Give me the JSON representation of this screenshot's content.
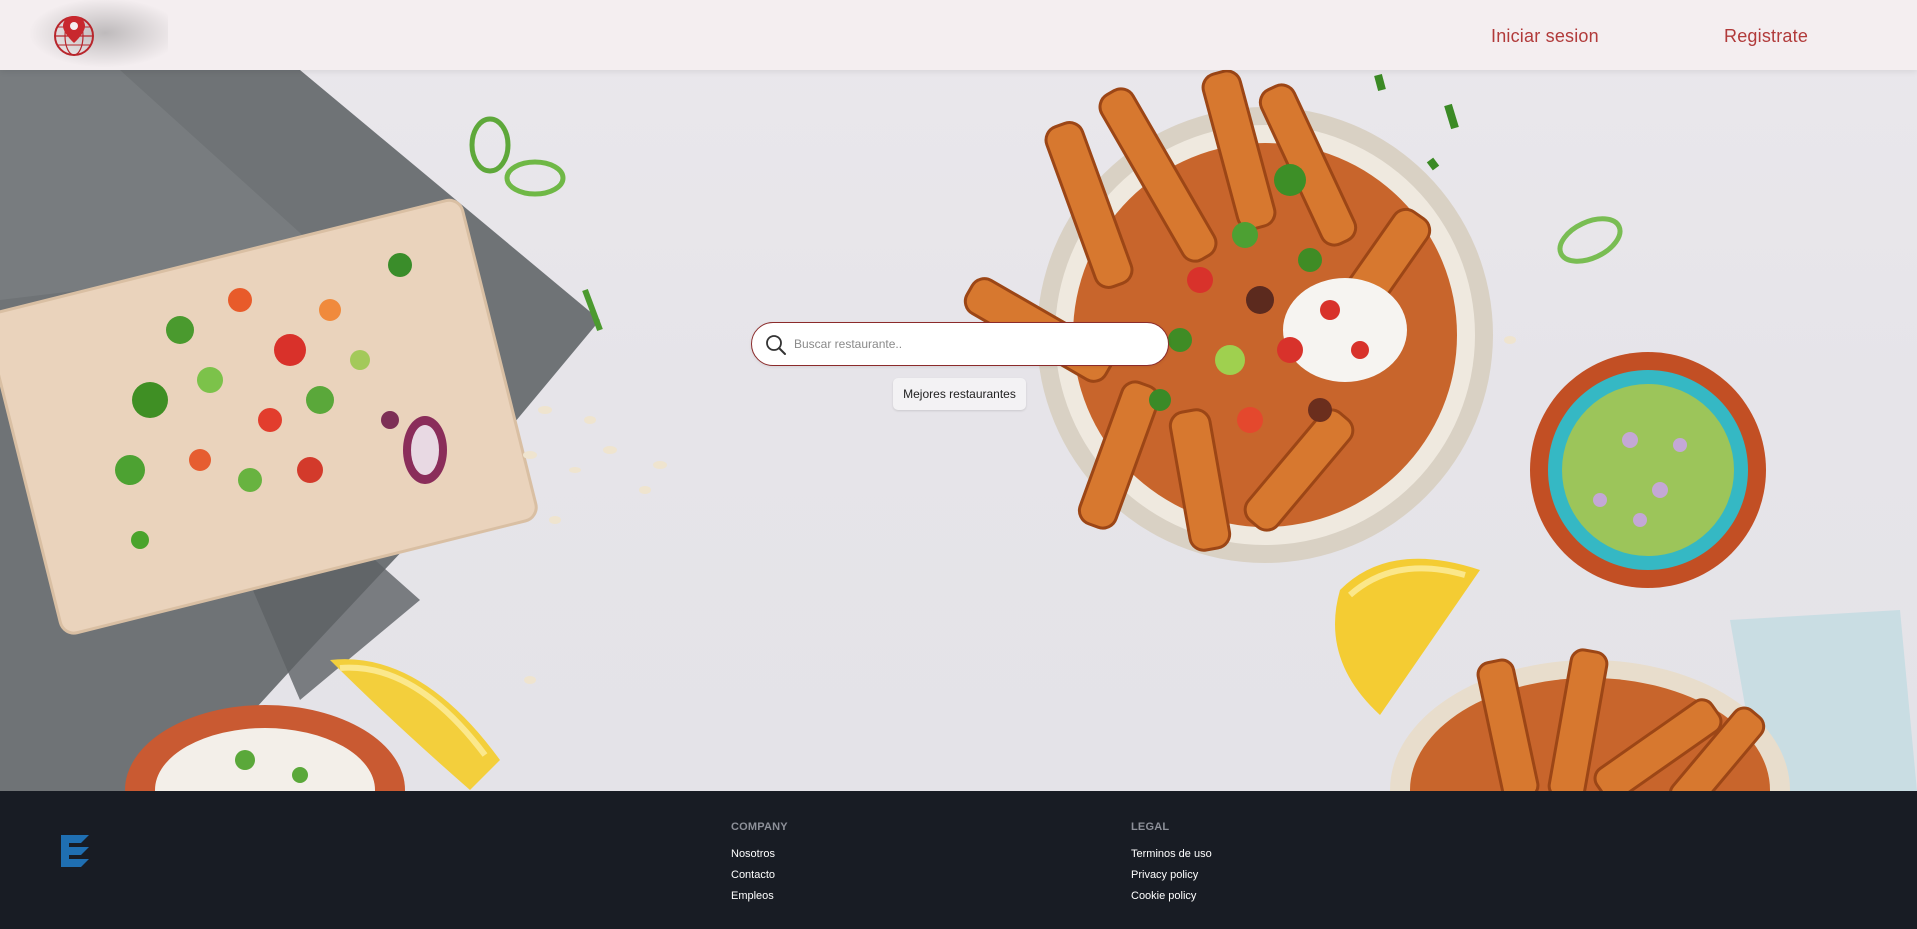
{
  "header": {
    "logo_icon": "map-pin-globe-icon",
    "login_label": "Iniciar sesion",
    "register_label": "Registrate"
  },
  "search": {
    "icon": "search-icon",
    "placeholder": "Buscar restaurante..",
    "value": ""
  },
  "best_button": {
    "label": "Mejores restaurantes"
  },
  "footer": {
    "logo_icon": "stacked-chevrons-logo-icon",
    "columns": [
      {
        "heading": "Company",
        "links": [
          "Nosotros",
          "Contacto",
          "Empleos"
        ]
      },
      {
        "heading": "Legal",
        "links": [
          "Terminos de uso",
          "Privacy policy",
          "Cookie policy"
        ]
      }
    ]
  },
  "colors": {
    "accent": "#b13a3a",
    "search_border": "#8b2b2b",
    "footer_bg": "#181c24",
    "footer_heading": "#8d9099",
    "footer_logo": "#1f6fb2"
  }
}
